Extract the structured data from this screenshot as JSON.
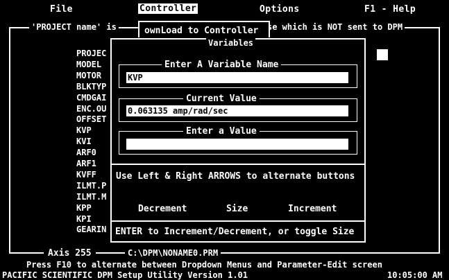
{
  "menubar": {
    "file": "File",
    "controller": "Controller",
    "options": "Options",
    "help": "F1 - Help"
  },
  "frame": {
    "title_left": "'PROJECT name' is",
    "title_right": "se which is NOT sent to DPM"
  },
  "params": [
    "PROJEC",
    "MODEL",
    "MOTOR",
    "BLKTYP",
    "CMDGAI",
    "ENC.OU",
    "OFFSET",
    "KVP",
    "KVI",
    "ARF0",
    "ARF1",
    "KVFF",
    "ILMT.P",
    "ILMT.M",
    "KPP",
    "KPI",
    "GEARIN"
  ],
  "dropdown": {
    "item": "ownLoad to Controller"
  },
  "dialog": {
    "title": "Variables",
    "name_label": "Enter A Variable Name",
    "name_value": "KVP",
    "current_label": "Current Value",
    "current_value": "0.063135 amp/rad/sec",
    "enter_label": "Enter a Value",
    "enter_value": "",
    "hint_arrows": "Use Left & Right ARROWS to alternate buttons",
    "btn_decrement": "Decrement",
    "btn_size": "Size",
    "btn_increment": "Increment",
    "hint_enter": "ENTER to Increment/Decrement, or toggle Size"
  },
  "bottom": {
    "axis": "Axis 255",
    "path": "C:\\DPM\\NONAME0.PRM",
    "hint": "Press F10 to alternate between Dropdown Menus and Parameter-Edit screen",
    "company": "PACIFIC SCIENTIFIC  DPM Setup Utility Version 1.01",
    "time": "10:05:00 AM"
  }
}
